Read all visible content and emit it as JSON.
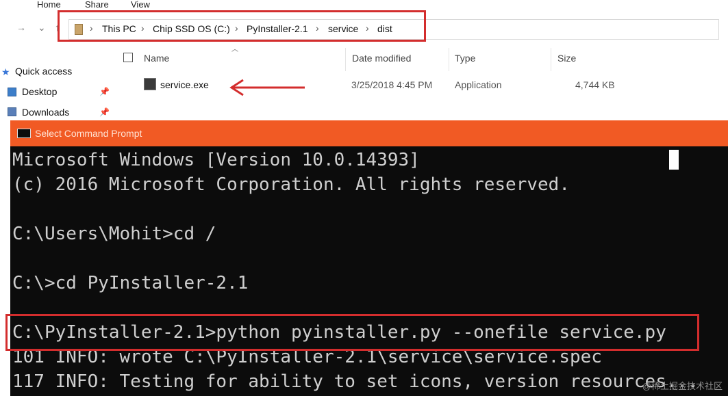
{
  "ribbon": {
    "tabs": [
      "Home",
      "Share",
      "View"
    ]
  },
  "address_bar": {
    "crumbs": [
      "This PC",
      "Chip SSD OS (C:)",
      "PyInstaller-2.1",
      "service",
      "dist"
    ]
  },
  "columns": {
    "name": "Name",
    "date_modified": "Date modified",
    "type": "Type",
    "size": "Size"
  },
  "sidebar": {
    "quick_access": "Quick access",
    "items": [
      "Desktop",
      "Downloads"
    ]
  },
  "files": [
    {
      "name": "service.exe",
      "date": "3/25/2018 4:45 PM",
      "type": "Application",
      "size": "4,744 KB"
    }
  ],
  "cmd": {
    "title": "Select Command Prompt",
    "lines": [
      "Microsoft Windows [Version 10.0.14393]",
      "(c) 2016 Microsoft Corporation. All rights reserved.",
      "",
      "C:\\Users\\Mohit>cd /",
      "",
      "C:\\>cd PyInstaller-2.1",
      "",
      "C:\\PyInstaller-2.1>python pyinstaller.py --onefile service.py",
      "101 INFO: wrote C:\\PyInstaller-2.1\\service\\service.spec",
      "117 INFO: Testing for ability to set icons, version resources..."
    ]
  },
  "watermark": "@稀土掘金技术社区",
  "colors": {
    "highlight": "#d32d2d",
    "cmd_titlebar": "#f15a24",
    "console_bg": "#0c0c0c",
    "console_text": "#cfcfcf"
  }
}
